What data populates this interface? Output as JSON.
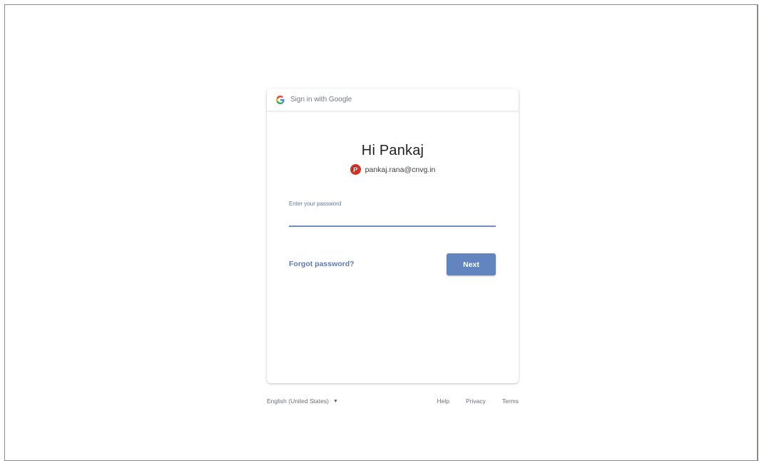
{
  "header": {
    "title": "Sign in with Google",
    "logo_icon": "google-g-icon"
  },
  "greeting": "Hi Pankaj",
  "account": {
    "avatar_initial": "P",
    "email": "pankaj.rana@cnvg.in"
  },
  "password": {
    "label": "Enter your password",
    "value": ""
  },
  "actions": {
    "forgot_label": "Forgot password?",
    "next_label": "Next"
  },
  "footer": {
    "language": "English (United States)",
    "links": [
      "Help",
      "Privacy",
      "Terms"
    ]
  },
  "colors": {
    "accent": "#6285c0",
    "link": "#5b7cb0",
    "frame_border": "#8f8a86"
  }
}
